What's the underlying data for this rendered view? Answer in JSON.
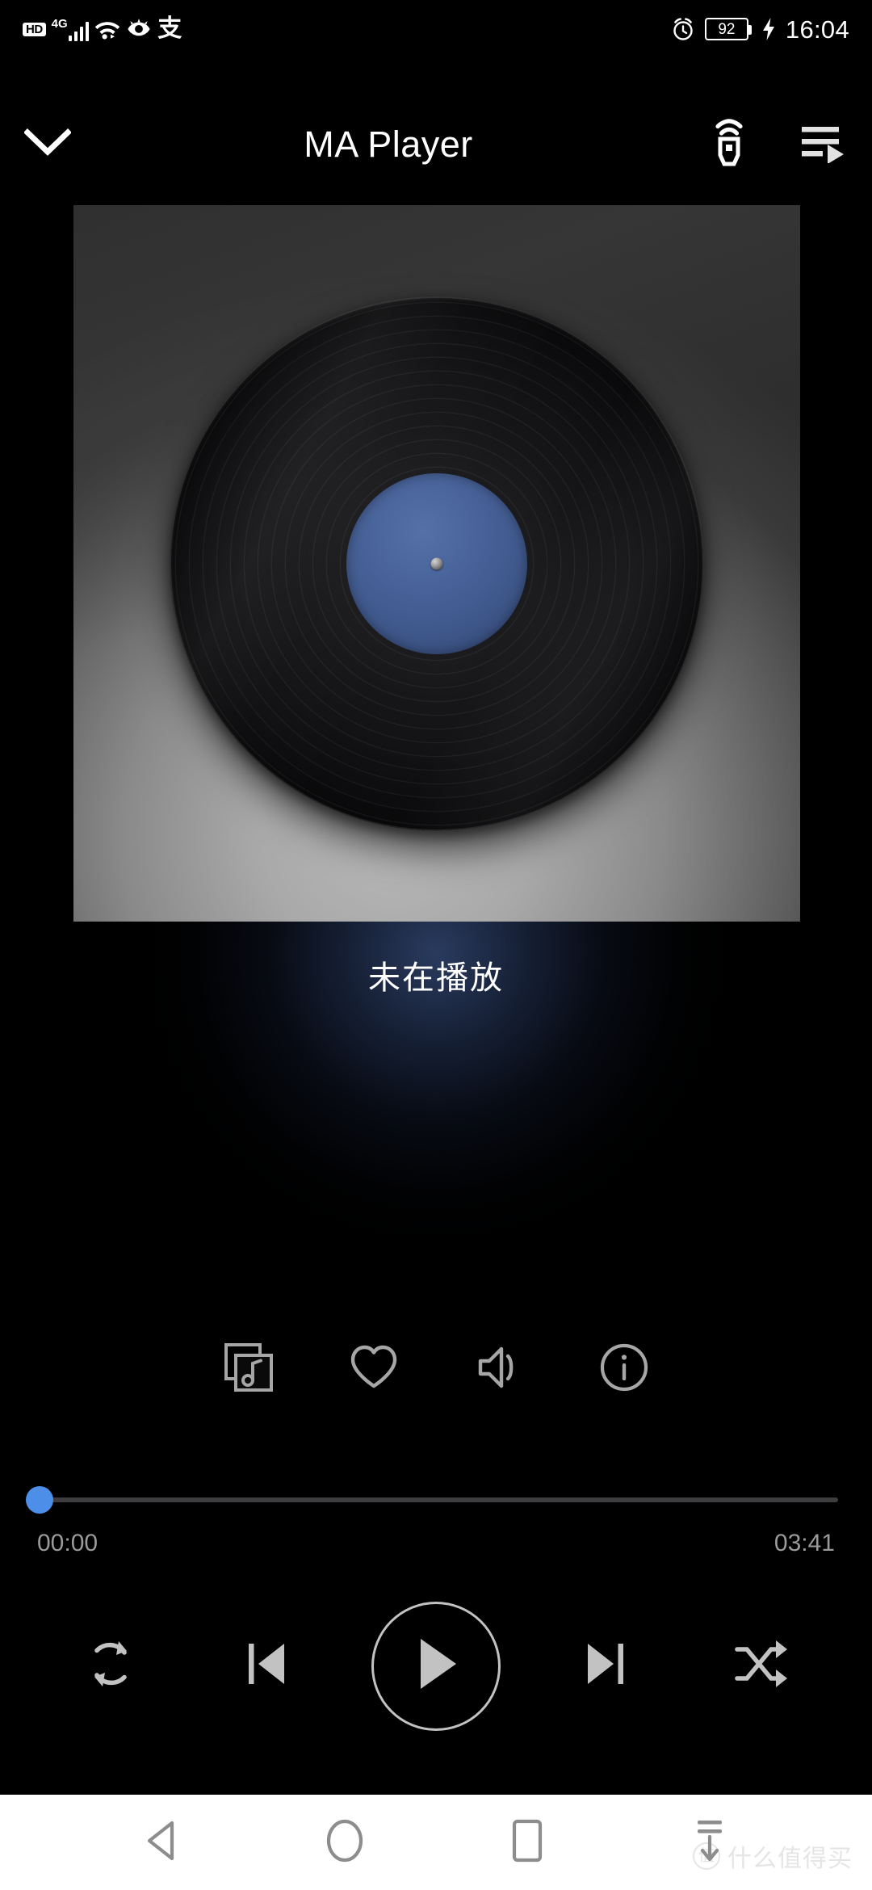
{
  "status_bar": {
    "hd_badge": "HD",
    "network_type": "4G",
    "signal_icon": "signal-bars-icon",
    "wifi_icon": "wifi-icon",
    "eye_comfort_icon": "eye-comfort-icon",
    "alipay_icon": "alipay-icon",
    "alipay_glyph": "支",
    "alarm_icon": "alarm-clock-icon",
    "battery_percent": "92",
    "charging_icon": "charging-bolt-icon",
    "time": "16:04"
  },
  "app_bar": {
    "collapse_icon": "chevron-down-icon",
    "title": "MA Player",
    "cast_icon": "cast-device-icon",
    "queue_icon": "play-queue-icon"
  },
  "album_art": {
    "type": "vinyl-record",
    "background_color": "#8a8a8a",
    "record_color": "#111113",
    "label_color": "#44608f"
  },
  "now_playing": {
    "title": "未在播放"
  },
  "actions": [
    {
      "name": "album-art-icon",
      "label": "Album"
    },
    {
      "name": "heart-icon",
      "label": "Favorite"
    },
    {
      "name": "volume-icon",
      "label": "Volume"
    },
    {
      "name": "info-icon",
      "label": "Info"
    }
  ],
  "seekbar": {
    "progress_percent": 0,
    "thumb_color": "#4d8fe8",
    "track_color": "#3d3d3f",
    "elapsed": "00:00",
    "duration": "03:41"
  },
  "transport": {
    "repeat_icon": "repeat-icon",
    "previous_icon": "previous-track-icon",
    "play_icon": "play-icon",
    "next_icon": "next-track-icon",
    "shuffle_icon": "shuffle-icon"
  },
  "nav_bar": {
    "back_icon": "back-triangle-icon",
    "home_icon": "home-circle-icon",
    "recents_icon": "recents-square-icon",
    "pulldown_icon": "notification-pulldown-icon"
  },
  "watermark": {
    "badge": "值",
    "text": "什么值得买"
  }
}
